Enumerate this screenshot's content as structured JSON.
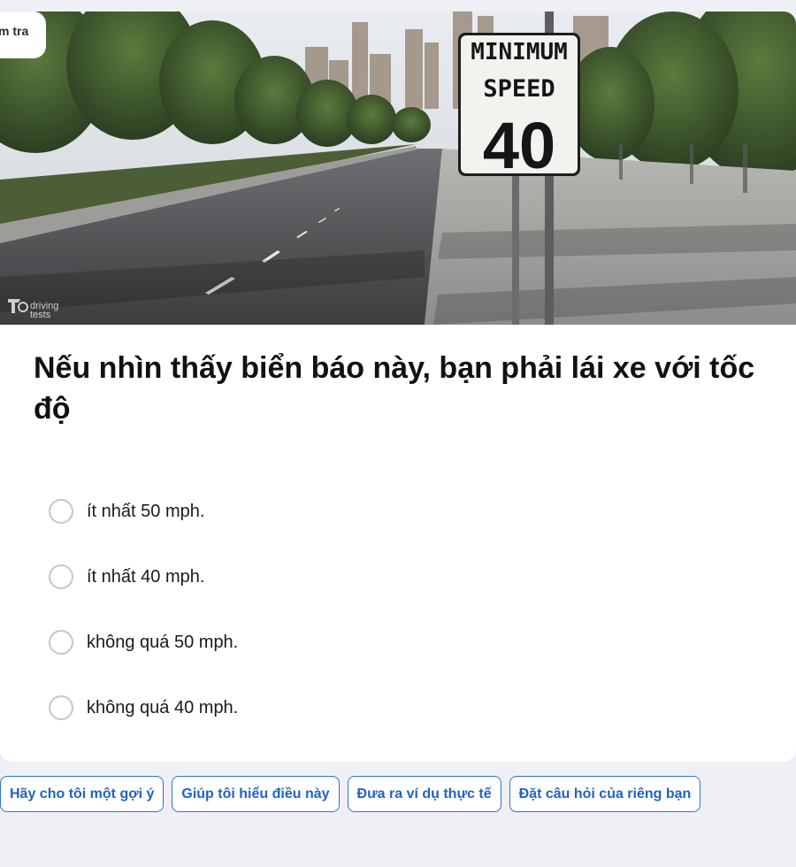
{
  "top_tag": "m tra",
  "image": {
    "sign_line1": "MINIMUM",
    "sign_line2": "SPEED",
    "sign_value": "40",
    "watermark_brand": "driving tests",
    "colors": {
      "sky": "#dde1e8",
      "foliage": "#3c5a2c",
      "road": "#4a4b4d",
      "sign_bg": "#f2f2ee"
    }
  },
  "question": "Nếu nhìn thấy biển báo này, bạn phải lái xe với tốc độ",
  "options": [
    {
      "label": "ít nhất 50 mph."
    },
    {
      "label": "ít nhất 40 mph."
    },
    {
      "label": "không quá 50 mph."
    },
    {
      "label": "không quá 40 mph."
    }
  ],
  "actions": [
    {
      "label": "Hãy cho tôi một gợi ý"
    },
    {
      "label": "Giúp tôi hiểu điều này"
    },
    {
      "label": "Đưa ra ví dụ thực tế"
    },
    {
      "label": "Đặt câu hỏi của riêng bạn"
    }
  ],
  "accent": "#2f74d0"
}
